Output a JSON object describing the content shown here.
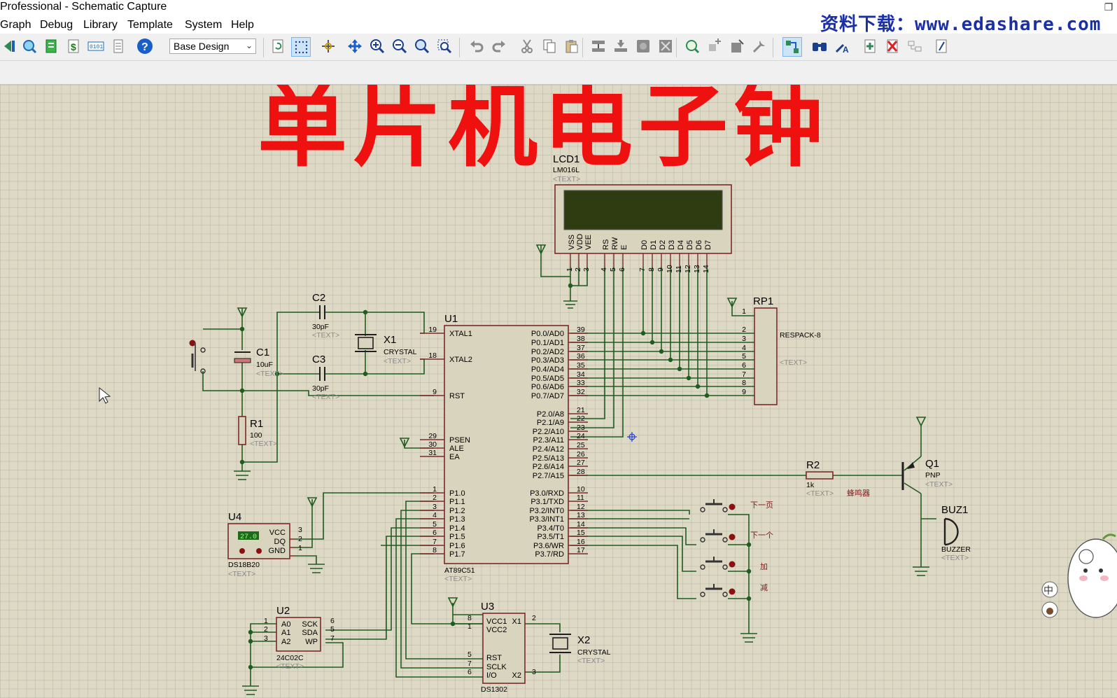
{
  "window": {
    "title": "Professional - Schematic Capture"
  },
  "menu": [
    "Graph",
    "Debug",
    "Library",
    "Template",
    "System",
    "Help"
  ],
  "watermark": "资料下载：www.edashare.com",
  "toolbar": {
    "design_select": "Base Design",
    "icons": [
      "run-icon",
      "find-icon",
      "netlist-icon",
      "bom-icon",
      "binary-icon",
      "document-icon",
      "help-icon",
      "refresh-icon",
      "grid-icon",
      "origin-icon",
      "pan-icon",
      "zoom-in-icon",
      "zoom-out-icon",
      "zoom-all-icon",
      "zoom-area-icon",
      "undo-icon",
      "redo-icon",
      "cut-icon",
      "copy-icon",
      "paste-icon",
      "block-copy-icon",
      "block-move-icon",
      "block-rotate-icon",
      "block-delete-icon",
      "pick-device-icon",
      "make-device-icon",
      "packaging-icon",
      "decompose-icon",
      "wire-autorouter-icon",
      "search-tag-icon",
      "property-assign-icon",
      "new-sheet-icon",
      "delete-sheet-icon",
      "goto-sheet-icon",
      "design-explorer-icon"
    ]
  },
  "schematic": {
    "title": "单片机电子钟",
    "components": {
      "lcd": {
        "ref": "LCD1",
        "value": "LM016L",
        "text": "<TEXT>",
        "pins": [
          "VSS",
          "VDD",
          "VEE",
          "RS",
          "RW",
          "E",
          "D0",
          "D1",
          "D2",
          "D3",
          "D4",
          "D5",
          "D6",
          "D7"
        ],
        "pin_numbers": [
          "1",
          "2",
          "3",
          "4",
          "5",
          "6",
          "7",
          "8",
          "9",
          "10",
          "11",
          "12",
          "13",
          "14"
        ]
      },
      "u1": {
        "ref": "U1",
        "value": "AT89C51",
        "text": "<TEXT>",
        "left_pins": [
          {
            "name": "XTAL1",
            "num": "19"
          },
          {
            "name": "XTAL2",
            "num": "18"
          },
          {
            "name": "RST",
            "num": "9"
          },
          {
            "name": "PSEN",
            "num": "29"
          },
          {
            "name": "ALE",
            "num": "30"
          },
          {
            "name": "EA",
            "num": "31"
          },
          {
            "name": "P1.0",
            "num": "1"
          },
          {
            "name": "P1.1",
            "num": "2"
          },
          {
            "name": "P1.2",
            "num": "3"
          },
          {
            "name": "P1.3",
            "num": "4"
          },
          {
            "name": "P1.4",
            "num": "5"
          },
          {
            "name": "P1.5",
            "num": "6"
          },
          {
            "name": "P1.6",
            "num": "7"
          },
          {
            "name": "P1.7",
            "num": "8"
          }
        ],
        "right_pins": [
          {
            "name": "P0.0/AD0",
            "num": "39"
          },
          {
            "name": "P0.1/AD1",
            "num": "38"
          },
          {
            "name": "P0.2/AD2",
            "num": "37"
          },
          {
            "name": "P0.3/AD3",
            "num": "36"
          },
          {
            "name": "P0.4/AD4",
            "num": "35"
          },
          {
            "name": "P0.5/AD5",
            "num": "34"
          },
          {
            "name": "P0.6/AD6",
            "num": "33"
          },
          {
            "name": "P0.7/AD7",
            "num": "32"
          },
          {
            "name": "P2.0/A8",
            "num": "21"
          },
          {
            "name": "P2.1/A9",
            "num": "22"
          },
          {
            "name": "P2.2/A10",
            "num": "23"
          },
          {
            "name": "P2.3/A11",
            "num": "24"
          },
          {
            "name": "P2.4/A12",
            "num": "25"
          },
          {
            "name": "P2.5/A13",
            "num": "26"
          },
          {
            "name": "P2.6/A14",
            "num": "27"
          },
          {
            "name": "P2.7/A15",
            "num": "28"
          },
          {
            "name": "P3.0/RXD",
            "num": "10"
          },
          {
            "name": "P3.1/TXD",
            "num": "11"
          },
          {
            "name": "P3.2/INT0",
            "num": "12"
          },
          {
            "name": "P3.3/INT1",
            "num": "13"
          },
          {
            "name": "P3.4/T0",
            "num": "14"
          },
          {
            "name": "P3.5/T1",
            "num": "15"
          },
          {
            "name": "P3.6/WR",
            "num": "16"
          },
          {
            "name": "P3.7/RD",
            "num": "17"
          }
        ]
      },
      "rp1": {
        "ref": "RP1",
        "value": "RESPACK-8",
        "text": "<TEXT>",
        "pin_numbers": [
          "1",
          "2",
          "3",
          "4",
          "5",
          "6",
          "7",
          "8",
          "9"
        ]
      },
      "c1": {
        "ref": "C1",
        "value": "10uF",
        "text": "<TEXT>"
      },
      "c2": {
        "ref": "C2",
        "value": "30pF",
        "text": "<TEXT>"
      },
      "c3": {
        "ref": "C3",
        "value": "30pF",
        "text": "<TEXT>"
      },
      "x1": {
        "ref": "X1",
        "value": "CRYSTAL",
        "text": "<TEXT>"
      },
      "r1": {
        "ref": "R1",
        "value": "100",
        "text": "<TEXT>"
      },
      "r2": {
        "ref": "R2",
        "value": "1k",
        "text": "<TEXT>",
        "note": "蜂鸣器"
      },
      "q1": {
        "ref": "Q1",
        "value": "PNP",
        "text": "<TEXT>"
      },
      "buz1": {
        "ref": "BUZ1",
        "value": "BUZZER",
        "text": "<TEXT>"
      },
      "u4": {
        "ref": "U4",
        "value": "DS18B20",
        "text": "<TEXT>",
        "reading": "27.0",
        "pins": [
          "VCC",
          "DQ",
          "GND"
        ],
        "pin_numbers": [
          "3",
          "2",
          "1"
        ]
      },
      "u2": {
        "ref": "U2",
        "value": "24C02C",
        "text": "<TEXT>",
        "left_pins": [
          "A0",
          "A1",
          "A2"
        ],
        "left_nums": [
          "1",
          "2",
          "3"
        ],
        "right_pins": [
          "SCK",
          "SDA",
          "WP"
        ],
        "right_nums": [
          "6",
          "5",
          "7"
        ]
      },
      "u3": {
        "ref": "U3",
        "value": "DS1302",
        "pins_left": [
          "VCC1",
          "VCC2",
          "RST",
          "SCLK",
          "I/O"
        ],
        "nums_left": [
          "8",
          "1",
          "5",
          "7",
          "6"
        ],
        "pins_right": [
          "X1",
          "X2"
        ],
        "nums_right": [
          "2",
          "3"
        ]
      },
      "x2": {
        "ref": "X2",
        "value": "CRYSTAL",
        "text": "<TEXT>"
      },
      "buttons": [
        "下一页",
        "下一个",
        "加",
        "减"
      ]
    },
    "side_icons": [
      "中",
      "🐻"
    ]
  }
}
